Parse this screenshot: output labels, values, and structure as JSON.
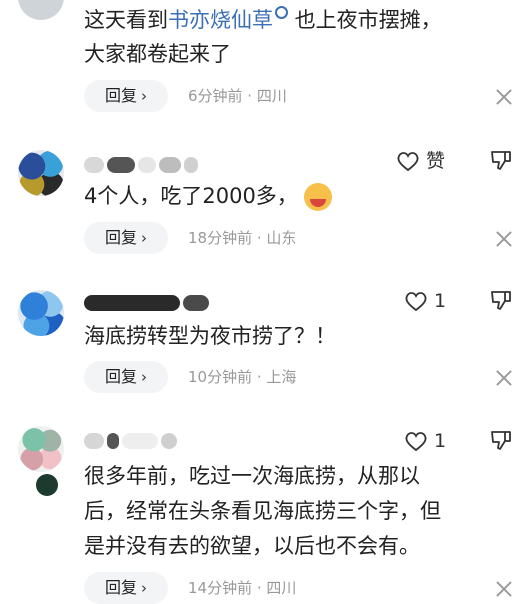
{
  "comments": [
    {
      "text_line1_prefix": "这天看到",
      "text_line1_link": "书亦烧仙草",
      "text_line1_suffix": " 也上夜市摆摊，",
      "text_line2": "大家都卷起来了",
      "reply_label": "回复",
      "meta": "6分钟前 · 四川"
    },
    {
      "text": "4个人，吃了2000多，",
      "reply_label": "回复",
      "meta": "18分钟前 · 山东",
      "like_label": "赞",
      "emoji": "face-emoji"
    },
    {
      "text": "海底捞转型为夜市捞了？！",
      "reply_label": "回复",
      "meta": "10分钟前 · 上海",
      "like_count": "1"
    },
    {
      "text_lines": [
        "很多年前，吃过一次海底捞，从那以",
        "后，经常在头条看见海底捞三个字，但",
        "是并没有去的欲望，以后也不会有。"
      ],
      "reply_label": "回复",
      "meta": "14分钟前 · 四川",
      "like_count": "1"
    }
  ],
  "icons": {
    "reply_chevron": "›",
    "close": "close-icon",
    "like": "heart-icon",
    "dislike": "dislike-icon",
    "search": "search-icon"
  },
  "colors": {
    "link": "#3b6fb6",
    "meta": "#999999",
    "text": "#222222",
    "reply_bg": "#f3f4f6"
  }
}
